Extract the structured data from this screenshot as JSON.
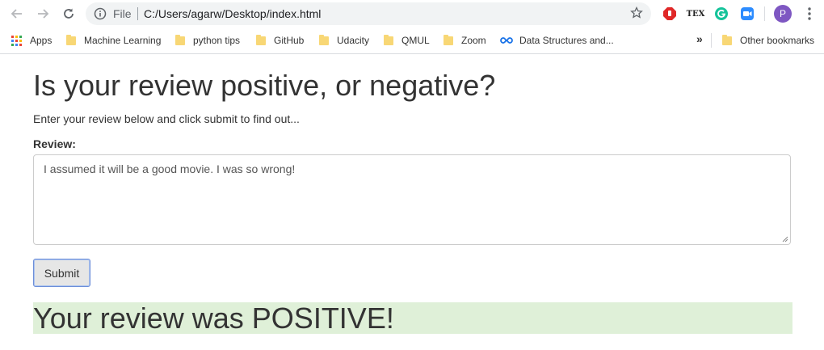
{
  "browser": {
    "omnibox": {
      "scheme_label": "File",
      "url": "C:/Users/agarw/Desktop/index.html"
    },
    "profile_initial": "P",
    "extension_tex_label": "TEX"
  },
  "bookmarks": {
    "apps_label": "Apps",
    "items": [
      {
        "label": "Machine Learning"
      },
      {
        "label": "python tips"
      },
      {
        "label": "GitHub"
      },
      {
        "label": "Udacity"
      },
      {
        "label": "QMUL"
      },
      {
        "label": "Zoom"
      },
      {
        "label": "Data Structures and..."
      }
    ],
    "overflow_label": "»",
    "other_label": "Other bookmarks"
  },
  "page": {
    "title": "Is your review positive, or negative?",
    "subtitle": "Enter your review below and click submit to find out...",
    "review_label": "Review:",
    "review_value": "I assumed it will be a good movie. I was so wrong!",
    "submit_label": "Submit",
    "result_text": "Your review was POSITIVE!",
    "result_color": "#dff0d8"
  }
}
